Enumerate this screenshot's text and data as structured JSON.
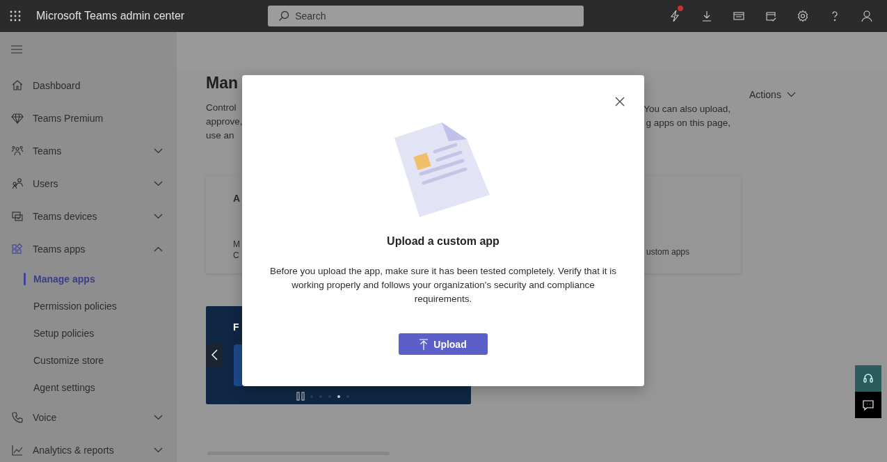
{
  "top_bar": {
    "title": "Microsoft Teams admin center",
    "search": {
      "placeholder": "Search"
    },
    "notification_badge": true
  },
  "sidebar": {
    "items": [
      {
        "label": "Dashboard",
        "kind": "link"
      },
      {
        "label": "Teams Premium",
        "kind": "link"
      },
      {
        "label": "Teams",
        "kind": "group",
        "expanded": false
      },
      {
        "label": "Users",
        "kind": "group",
        "expanded": false
      },
      {
        "label": "Teams devices",
        "kind": "group",
        "expanded": false
      },
      {
        "label": "Teams apps",
        "kind": "group",
        "expanded": true,
        "children": [
          {
            "label": "Manage apps",
            "selected": true
          },
          {
            "label": "Permission policies",
            "selected": false
          },
          {
            "label": "Setup policies",
            "selected": false
          },
          {
            "label": "Customize store",
            "selected": false
          },
          {
            "label": "Agent settings",
            "selected": false
          }
        ]
      },
      {
        "label": "Voice",
        "kind": "group",
        "expanded": false
      },
      {
        "label": "Analytics & reports",
        "kind": "group",
        "expanded": false
      }
    ]
  },
  "page": {
    "title": "Man",
    "description_left": [
      "Control",
      "approve,",
      "use an"
    ],
    "actions": "Actions",
    "description_right": [
      "You can also upload,",
      "g apps on this page,"
    ],
    "summary_card": {
      "heading": "A",
      "lines": [
        "M",
        "C"
      ],
      "right_text": "ustom apps"
    },
    "featured_banner": {
      "heading": "F",
      "dots": [
        {
          "selected": false
        },
        {
          "selected": false
        },
        {
          "selected": false
        },
        {
          "selected": true
        },
        {
          "selected": false
        }
      ]
    }
  },
  "dialog": {
    "title": "Upload a custom app",
    "message": "Before you upload the app, make sure it has been tested completely. Verify that it is working properly and follows your organization's security and compliance requirements.",
    "button": "Upload"
  }
}
